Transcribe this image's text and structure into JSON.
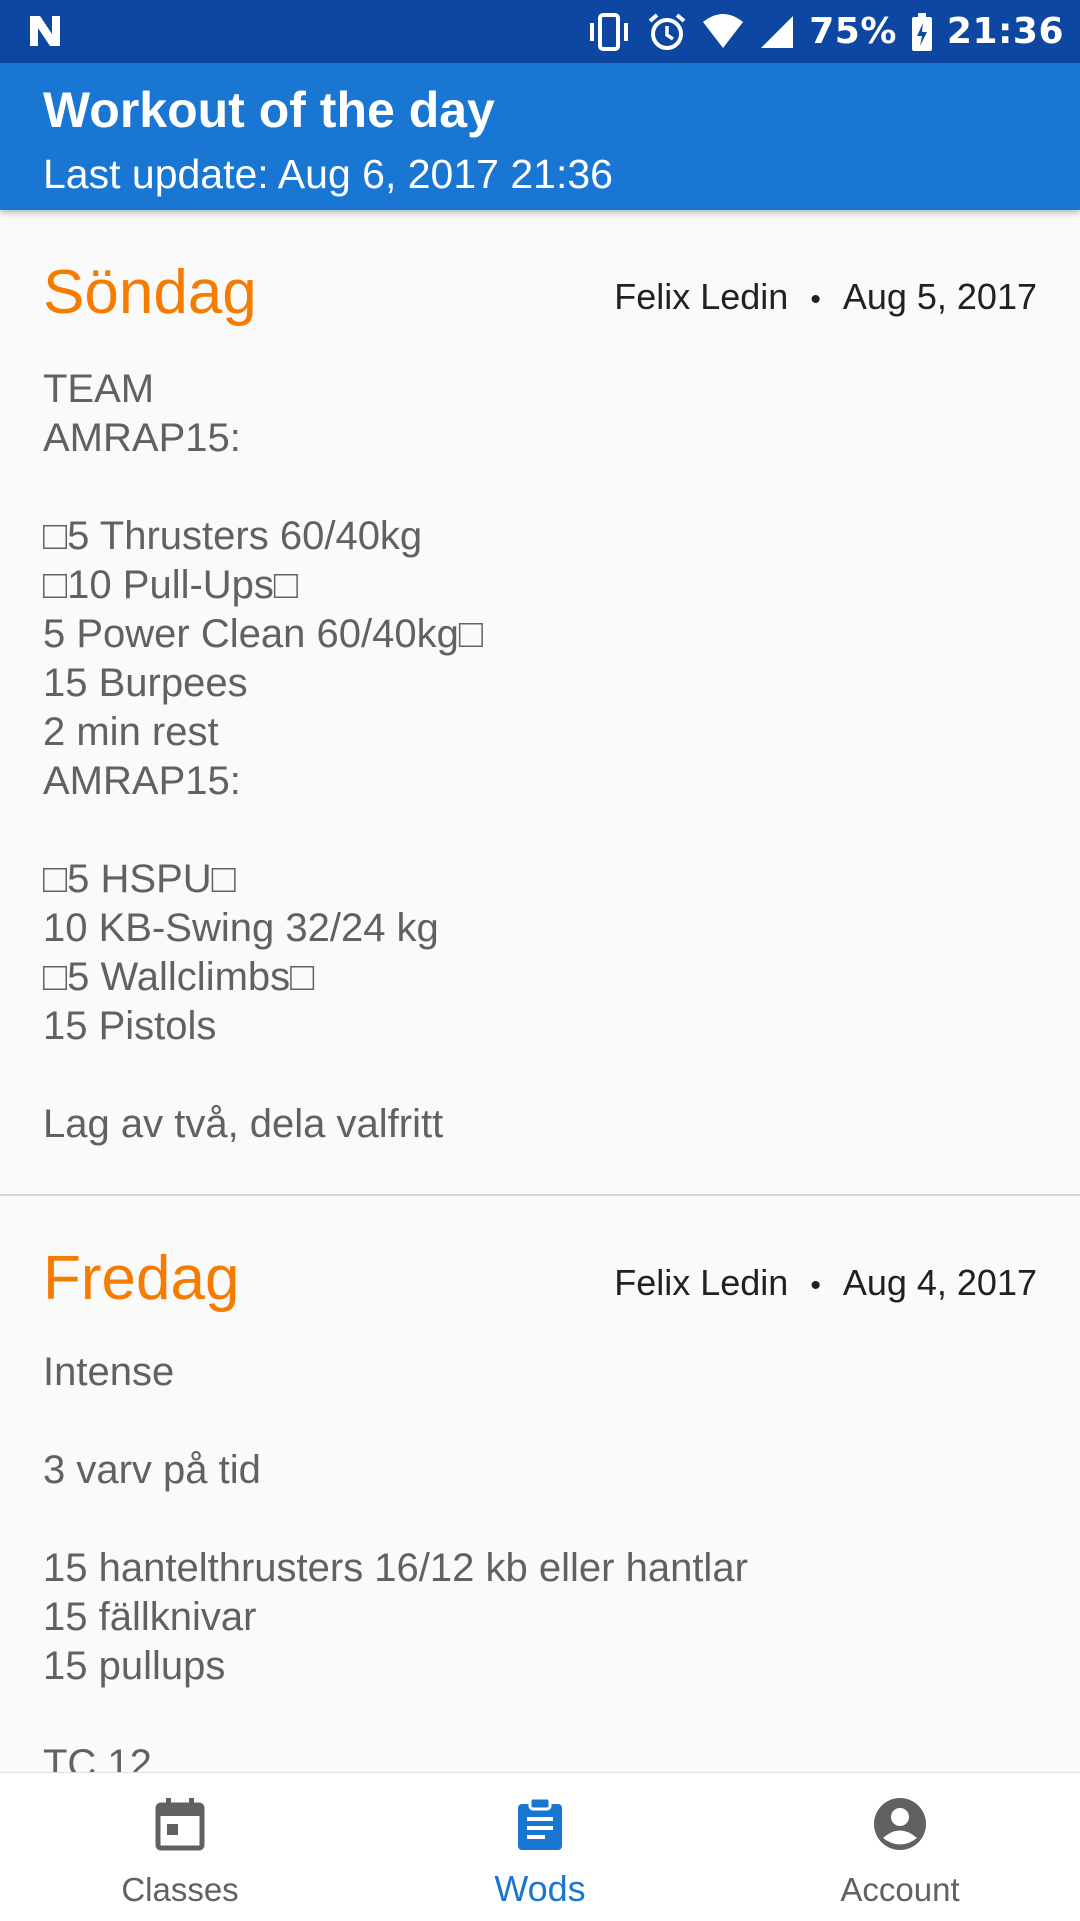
{
  "status_bar": {
    "battery": "75%",
    "time": "21:36",
    "icons": [
      "n-icon",
      "vibrate-icon",
      "alarm-icon",
      "wifi-icon",
      "signal-icon",
      "battery-charging-icon"
    ]
  },
  "app_bar": {
    "title": "Workout of the day",
    "subtitle": "Last update: Aug 6, 2017 21:36"
  },
  "posts": [
    {
      "day": "Söndag",
      "author": "Felix Ledin",
      "separator": "•",
      "date": "Aug 5, 2017",
      "body": "TEAM\nAMRAP15:\n\n□5 Thrusters 60/40kg\n□10 Pull-Ups□\n5 Power Clean 60/40kg□\n15 Burpees\n2 min rest\nAMRAP15:\n\n□5 HSPU□\n10 KB-Swing 32/24 kg\n□5 Wallclimbs□\n15 Pistols\n\nLag av två, dela valfritt"
    },
    {
      "day": "Fredag",
      "author": "Felix Ledin",
      "separator": "•",
      "date": "Aug 4, 2017",
      "body": "Intense\n\n3 varv på tid\n\n15 hantelthrusters 16/12 kb eller hantlar\n15 fällknivar\n15 pullups\n\nTC 12"
    }
  ],
  "bottom_nav": {
    "items": [
      {
        "label": "Classes",
        "icon": "calendar-icon",
        "active": false
      },
      {
        "label": "Wods",
        "icon": "clipboard-icon",
        "active": true
      },
      {
        "label": "Account",
        "icon": "account-icon",
        "active": false
      }
    ]
  },
  "colors": {
    "status_bar": "#0d47a1",
    "app_bar": "#1976d2",
    "day_title": "#f57c00",
    "active_nav": "#1976d2",
    "inactive_nav": "#616161"
  }
}
